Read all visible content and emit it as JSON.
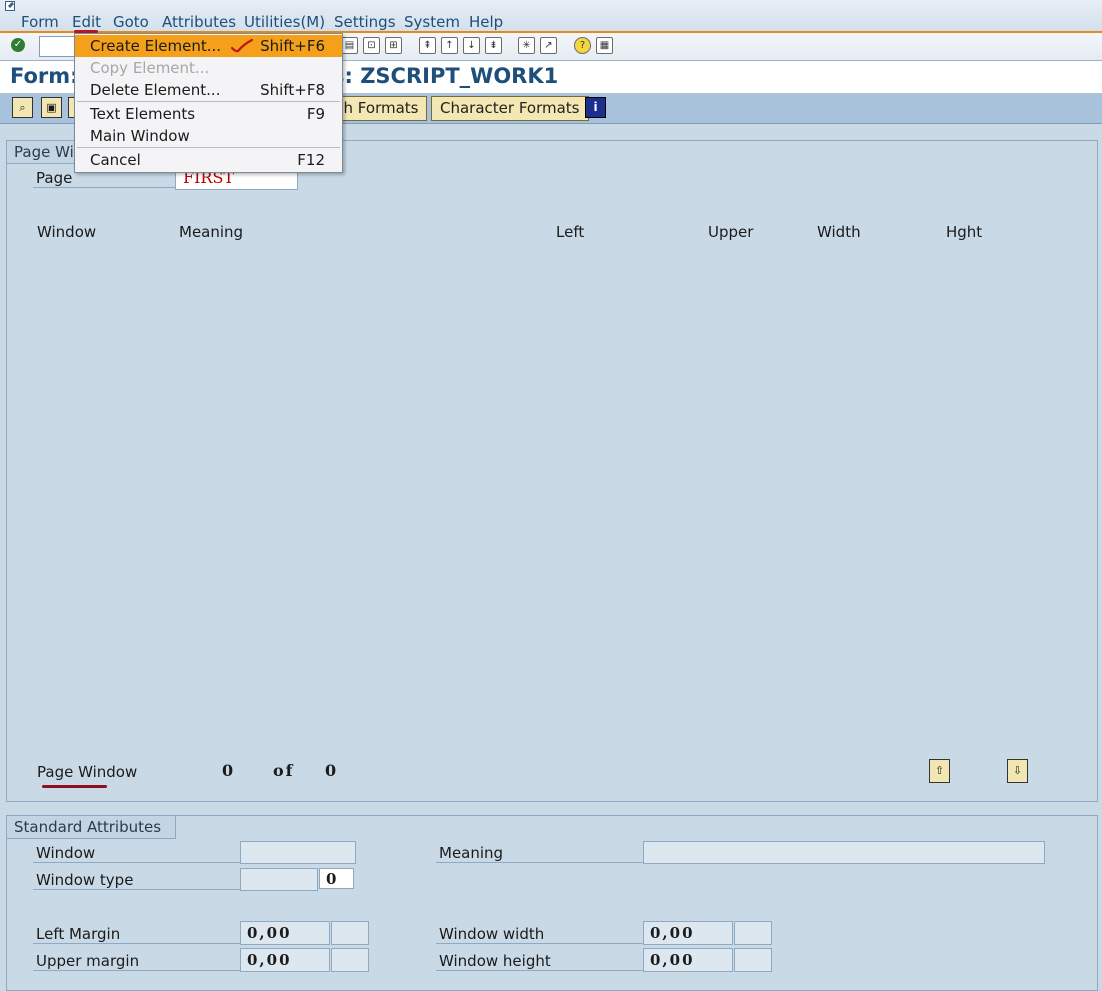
{
  "menubar": {
    "items": [
      "Form",
      "Edit",
      "Goto",
      "Attributes",
      "Utilities(M)",
      "Settings",
      "System",
      "Help"
    ]
  },
  "title": {
    "left": "Form:",
    "right": "s: ZSCRIPT_WORK1"
  },
  "app_toolbar": {
    "buttons": [
      "ph Formats",
      "Character Formats"
    ]
  },
  "dropdown": {
    "items": [
      {
        "label": "Create Element...",
        "shortcut": "Shift+F6",
        "state": "selected"
      },
      {
        "label": "Copy Element...",
        "shortcut": "",
        "state": "disabled"
      },
      {
        "label": "Delete Element...",
        "shortcut": "Shift+F8",
        "state": "normal"
      },
      {
        "label": "Text Elements",
        "shortcut": "F9",
        "state": "normal"
      },
      {
        "label": "Main Window",
        "shortcut": "",
        "state": "normal"
      },
      {
        "label": "Cancel",
        "shortcut": "F12",
        "state": "normal"
      }
    ]
  },
  "page_windows": {
    "tab_label": "Page Wi",
    "page_label": "Page",
    "page_value": "FIRST",
    "columns": [
      "Window",
      "Meaning",
      "Left",
      "Upper",
      "Width",
      "Hght"
    ],
    "footer_label": "Page Window",
    "current": "0",
    "of_text": "of",
    "total": "0"
  },
  "standard_attributes": {
    "tab_label": "Standard Attributes",
    "window_label": "Window",
    "window_value": "",
    "meaning_label": "Meaning",
    "meaning_value": "",
    "window_type_label": "Window type",
    "window_type_value": "",
    "window_type_code": "0",
    "left_margin_label": "Left Margin",
    "left_margin_value": "0,00",
    "upper_margin_label": "Upper margin",
    "upper_margin_value": "0,00",
    "window_width_label": "Window width",
    "window_width_value": "0,00",
    "window_height_label": "Window height",
    "window_height_value": "0,00"
  },
  "colors": {
    "accent": "#e58a1a",
    "selection": "#f4a01a",
    "title": "#1e4f7a",
    "page_value": "#c00000",
    "annotation": "#b8161d"
  }
}
